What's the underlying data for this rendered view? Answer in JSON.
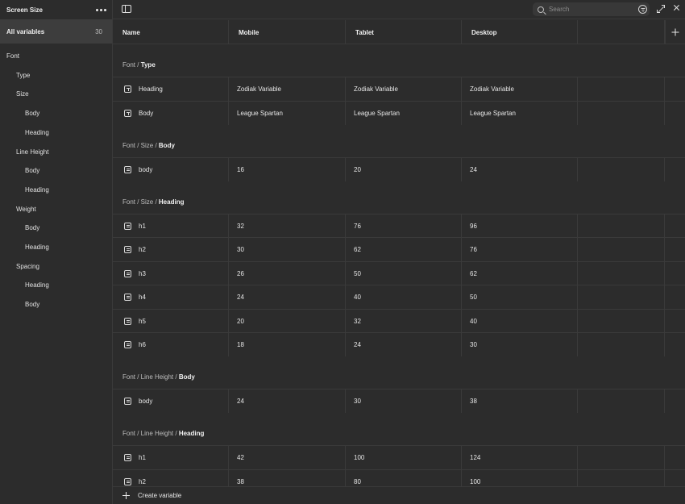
{
  "sidebar": {
    "title": "Screen Size",
    "all_variables": {
      "label": "All variables",
      "count": "30"
    },
    "tree": [
      {
        "label": "Font",
        "level": 0
      },
      {
        "label": "Type",
        "level": 1
      },
      {
        "label": "Size",
        "level": 1
      },
      {
        "label": "Body",
        "level": 2
      },
      {
        "label": "Heading",
        "level": 2
      },
      {
        "label": "Line Height",
        "level": 1
      },
      {
        "label": "Body",
        "level": 2
      },
      {
        "label": "Heading",
        "level": 2
      },
      {
        "label": "Weight",
        "level": 1
      },
      {
        "label": "Body",
        "level": 2
      },
      {
        "label": "Heading",
        "level": 2
      },
      {
        "label": "Spacing",
        "level": 1
      },
      {
        "label": "Heading",
        "level": 2
      },
      {
        "label": "Body",
        "level": 2
      }
    ]
  },
  "toolbar": {
    "search_placeholder": "Search"
  },
  "table": {
    "columns": [
      "Name",
      "Mobile",
      "Tablet",
      "Desktop"
    ],
    "groups": [
      {
        "path": "Font / ",
        "leaf": "Type",
        "rows": [
          {
            "icon": "text",
            "name": "Heading",
            "values": [
              "Zodiak Variable",
              "Zodiak Variable",
              "Zodiak Variable"
            ]
          },
          {
            "icon": "text",
            "name": "Body",
            "values": [
              "League Spartan",
              "League Spartan",
              "League Spartan"
            ]
          }
        ]
      },
      {
        "path": "Font / Size / ",
        "leaf": "Body",
        "rows": [
          {
            "icon": "number",
            "name": "body",
            "values": [
              "16",
              "20",
              "24"
            ]
          }
        ]
      },
      {
        "path": "Font / Size / ",
        "leaf": "Heading",
        "rows": [
          {
            "icon": "number",
            "name": "h1",
            "values": [
              "32",
              "76",
              "96"
            ]
          },
          {
            "icon": "number",
            "name": "h2",
            "values": [
              "30",
              "62",
              "76"
            ]
          },
          {
            "icon": "number",
            "name": "h3",
            "values": [
              "26",
              "50",
              "62"
            ]
          },
          {
            "icon": "number",
            "name": "h4",
            "values": [
              "24",
              "40",
              "50"
            ]
          },
          {
            "icon": "number",
            "name": "h5",
            "values": [
              "20",
              "32",
              "40"
            ]
          },
          {
            "icon": "number",
            "name": "h6",
            "values": [
              "18",
              "24",
              "30"
            ]
          }
        ]
      },
      {
        "path": "Font / Line Height / ",
        "leaf": "Body",
        "rows": [
          {
            "icon": "number",
            "name": "body",
            "values": [
              "24",
              "30",
              "38"
            ]
          }
        ]
      },
      {
        "path": "Font / Line Height / ",
        "leaf": "Heading",
        "rows": [
          {
            "icon": "number",
            "name": "h1",
            "values": [
              "42",
              "100",
              "124"
            ]
          },
          {
            "icon": "number",
            "name": "h2",
            "values": [
              "38",
              "80",
              "100"
            ]
          }
        ]
      }
    ]
  },
  "footer": {
    "create_label": "Create variable"
  }
}
